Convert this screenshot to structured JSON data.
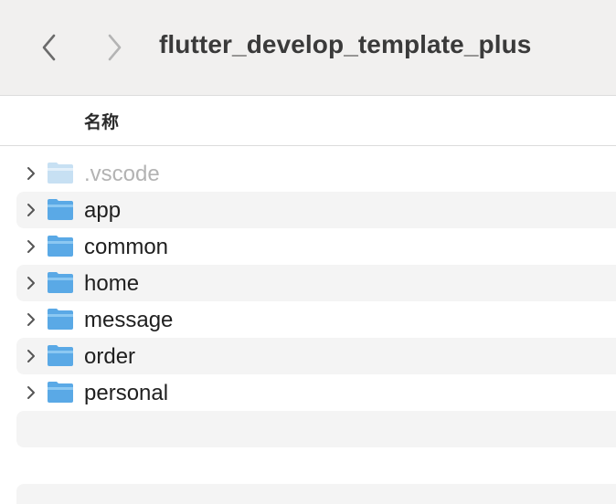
{
  "window": {
    "title": "flutter_develop_template_plus"
  },
  "toolbar": {
    "back_icon": "chevron-left-icon",
    "forward_icon": "chevron-right-icon"
  },
  "columns": {
    "name_header": "名称"
  },
  "files": [
    {
      "name": ".vscode",
      "icon": "folder-icon",
      "dimmed": true
    },
    {
      "name": "app",
      "icon": "folder-icon",
      "dimmed": false
    },
    {
      "name": "common",
      "icon": "folder-icon",
      "dimmed": false
    },
    {
      "name": "home",
      "icon": "folder-icon",
      "dimmed": false
    },
    {
      "name": "message",
      "icon": "folder-icon",
      "dimmed": false
    },
    {
      "name": "order",
      "icon": "folder-icon",
      "dimmed": false
    },
    {
      "name": "personal",
      "icon": "folder-icon",
      "dimmed": false
    }
  ],
  "colors": {
    "folder_blue": "#5aa9e6",
    "folder_dim": "#c7e0f3",
    "row_alt": "#f4f4f4",
    "toolbar_bg": "#f1f0ef"
  }
}
